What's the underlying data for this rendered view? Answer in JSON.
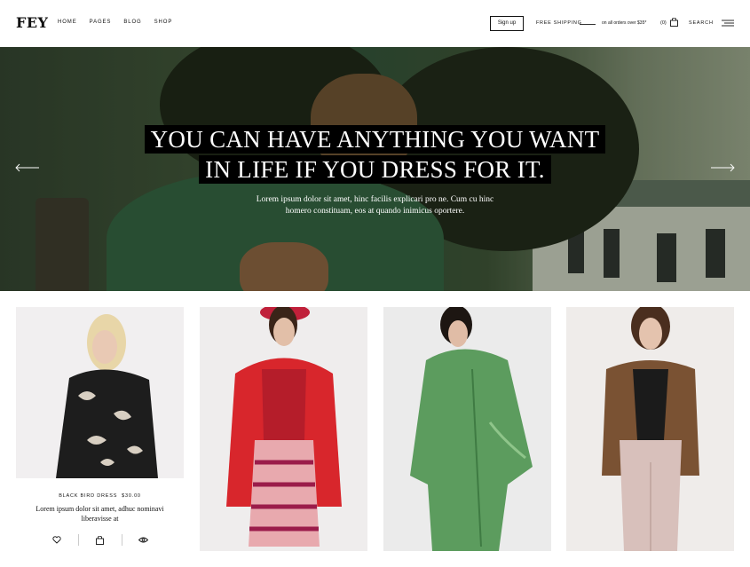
{
  "brand": {
    "logo": "FEY"
  },
  "nav": {
    "items": [
      {
        "label": "HOME"
      },
      {
        "label": "PAGES"
      },
      {
        "label": "BLOG"
      },
      {
        "label": "SHOP"
      }
    ]
  },
  "header": {
    "signup_label": "Sign up",
    "free_shipping": "FREE SHIPPING",
    "shipping_note": "on all orders over $35*",
    "cart_count": "(0)",
    "search_label": "SEARCH"
  },
  "hero": {
    "title_line1": "YOU CAN HAVE ANYTHING YOU WANT",
    "title_line2": "IN LIFE IF YOU DRESS FOR IT.",
    "subtitle_line1": "Lorem ipsum dolor sit amet, hinc facilis explicari pro ne. Cum cu hinc",
    "subtitle_line2": "homero constituam, eos at quando inimicus oportere."
  },
  "products": [
    {
      "name": "BLACK BIRD DRESS",
      "price": "$30.00",
      "desc_line1": "Lorem ipsum dolor sit amet, adhuc nominavi",
      "desc_line2": "liberavisse at"
    }
  ],
  "colors": {
    "accent": "#111111",
    "hero_bg": "#2f4a33",
    "product_bg": "#f0efee"
  }
}
